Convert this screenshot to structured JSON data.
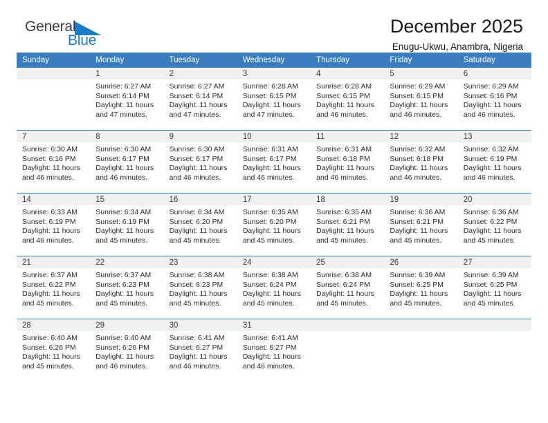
{
  "logo": {
    "word1": "General",
    "word2": "Blue",
    "triangle_color": "#1f7ac4",
    "word1_color": "#3b3b3b",
    "word2_color": "#1f7ac4"
  },
  "header": {
    "title": "December 2025",
    "subtitle": "Enugu-Ukwu, Anambra, Nigeria"
  },
  "theme": {
    "header_blue": "#3a7dbf",
    "band_gray": "#f0f0f0",
    "text_dark": "#2b2b2b"
  },
  "weekdays": [
    "Sunday",
    "Monday",
    "Tuesday",
    "Wednesday",
    "Thursday",
    "Friday",
    "Saturday"
  ],
  "weeks": [
    [
      {
        "day": "",
        "empty": true,
        "sunrise": "",
        "sunset": "",
        "daylight_l1": "",
        "daylight_l2": ""
      },
      {
        "day": "1",
        "sunrise": "Sunrise: 6:27 AM",
        "sunset": "Sunset: 6:14 PM",
        "daylight_l1": "Daylight: 11 hours",
        "daylight_l2": "and 47 minutes."
      },
      {
        "day": "2",
        "sunrise": "Sunrise: 6:27 AM",
        "sunset": "Sunset: 6:14 PM",
        "daylight_l1": "Daylight: 11 hours",
        "daylight_l2": "and 47 minutes."
      },
      {
        "day": "3",
        "sunrise": "Sunrise: 6:28 AM",
        "sunset": "Sunset: 6:15 PM",
        "daylight_l1": "Daylight: 11 hours",
        "daylight_l2": "and 47 minutes."
      },
      {
        "day": "4",
        "sunrise": "Sunrise: 6:28 AM",
        "sunset": "Sunset: 6:15 PM",
        "daylight_l1": "Daylight: 11 hours",
        "daylight_l2": "and 46 minutes."
      },
      {
        "day": "5",
        "sunrise": "Sunrise: 6:29 AM",
        "sunset": "Sunset: 6:15 PM",
        "daylight_l1": "Daylight: 11 hours",
        "daylight_l2": "and 46 minutes."
      },
      {
        "day": "6",
        "sunrise": "Sunrise: 6:29 AM",
        "sunset": "Sunset: 6:16 PM",
        "daylight_l1": "Daylight: 11 hours",
        "daylight_l2": "and 46 minutes."
      }
    ],
    [
      {
        "day": "7",
        "sunrise": "Sunrise: 6:30 AM",
        "sunset": "Sunset: 6:16 PM",
        "daylight_l1": "Daylight: 11 hours",
        "daylight_l2": "and 46 minutes."
      },
      {
        "day": "8",
        "sunrise": "Sunrise: 6:30 AM",
        "sunset": "Sunset: 6:17 PM",
        "daylight_l1": "Daylight: 11 hours",
        "daylight_l2": "and 46 minutes."
      },
      {
        "day": "9",
        "sunrise": "Sunrise: 6:30 AM",
        "sunset": "Sunset: 6:17 PM",
        "daylight_l1": "Daylight: 11 hours",
        "daylight_l2": "and 46 minutes."
      },
      {
        "day": "10",
        "sunrise": "Sunrise: 6:31 AM",
        "sunset": "Sunset: 6:17 PM",
        "daylight_l1": "Daylight: 11 hours",
        "daylight_l2": "and 46 minutes."
      },
      {
        "day": "11",
        "sunrise": "Sunrise: 6:31 AM",
        "sunset": "Sunset: 6:18 PM",
        "daylight_l1": "Daylight: 11 hours",
        "daylight_l2": "and 46 minutes."
      },
      {
        "day": "12",
        "sunrise": "Sunrise: 6:32 AM",
        "sunset": "Sunset: 6:18 PM",
        "daylight_l1": "Daylight: 11 hours",
        "daylight_l2": "and 46 minutes."
      },
      {
        "day": "13",
        "sunrise": "Sunrise: 6:32 AM",
        "sunset": "Sunset: 6:19 PM",
        "daylight_l1": "Daylight: 11 hours",
        "daylight_l2": "and 46 minutes."
      }
    ],
    [
      {
        "day": "14",
        "sunrise": "Sunrise: 6:33 AM",
        "sunset": "Sunset: 6:19 PM",
        "daylight_l1": "Daylight: 11 hours",
        "daylight_l2": "and 46 minutes."
      },
      {
        "day": "15",
        "sunrise": "Sunrise: 6:34 AM",
        "sunset": "Sunset: 6:19 PM",
        "daylight_l1": "Daylight: 11 hours",
        "daylight_l2": "and 45 minutes."
      },
      {
        "day": "16",
        "sunrise": "Sunrise: 6:34 AM",
        "sunset": "Sunset: 6:20 PM",
        "daylight_l1": "Daylight: 11 hours",
        "daylight_l2": "and 45 minutes."
      },
      {
        "day": "17",
        "sunrise": "Sunrise: 6:35 AM",
        "sunset": "Sunset: 6:20 PM",
        "daylight_l1": "Daylight: 11 hours",
        "daylight_l2": "and 45 minutes."
      },
      {
        "day": "18",
        "sunrise": "Sunrise: 6:35 AM",
        "sunset": "Sunset: 6:21 PM",
        "daylight_l1": "Daylight: 11 hours",
        "daylight_l2": "and 45 minutes."
      },
      {
        "day": "19",
        "sunrise": "Sunrise: 6:36 AM",
        "sunset": "Sunset: 6:21 PM",
        "daylight_l1": "Daylight: 11 hours",
        "daylight_l2": "and 45 minutes."
      },
      {
        "day": "20",
        "sunrise": "Sunrise: 6:36 AM",
        "sunset": "Sunset: 6:22 PM",
        "daylight_l1": "Daylight: 11 hours",
        "daylight_l2": "and 45 minutes."
      }
    ],
    [
      {
        "day": "21",
        "sunrise": "Sunrise: 6:37 AM",
        "sunset": "Sunset: 6:22 PM",
        "daylight_l1": "Daylight: 11 hours",
        "daylight_l2": "and 45 minutes."
      },
      {
        "day": "22",
        "sunrise": "Sunrise: 6:37 AM",
        "sunset": "Sunset: 6:23 PM",
        "daylight_l1": "Daylight: 11 hours",
        "daylight_l2": "and 45 minutes."
      },
      {
        "day": "23",
        "sunrise": "Sunrise: 6:38 AM",
        "sunset": "Sunset: 6:23 PM",
        "daylight_l1": "Daylight: 11 hours",
        "daylight_l2": "and 45 minutes."
      },
      {
        "day": "24",
        "sunrise": "Sunrise: 6:38 AM",
        "sunset": "Sunset: 6:24 PM",
        "daylight_l1": "Daylight: 11 hours",
        "daylight_l2": "and 45 minutes."
      },
      {
        "day": "25",
        "sunrise": "Sunrise: 6:38 AM",
        "sunset": "Sunset: 6:24 PM",
        "daylight_l1": "Daylight: 11 hours",
        "daylight_l2": "and 45 minutes."
      },
      {
        "day": "26",
        "sunrise": "Sunrise: 6:39 AM",
        "sunset": "Sunset: 6:25 PM",
        "daylight_l1": "Daylight: 11 hours",
        "daylight_l2": "and 45 minutes."
      },
      {
        "day": "27",
        "sunrise": "Sunrise: 6:39 AM",
        "sunset": "Sunset: 6:25 PM",
        "daylight_l1": "Daylight: 11 hours",
        "daylight_l2": "and 45 minutes."
      }
    ],
    [
      {
        "day": "28",
        "sunrise": "Sunrise: 6:40 AM",
        "sunset": "Sunset: 6:26 PM",
        "daylight_l1": "Daylight: 11 hours",
        "daylight_l2": "and 45 minutes."
      },
      {
        "day": "29",
        "sunrise": "Sunrise: 6:40 AM",
        "sunset": "Sunset: 6:26 PM",
        "daylight_l1": "Daylight: 11 hours",
        "daylight_l2": "and 46 minutes."
      },
      {
        "day": "30",
        "sunrise": "Sunrise: 6:41 AM",
        "sunset": "Sunset: 6:27 PM",
        "daylight_l1": "Daylight: 11 hours",
        "daylight_l2": "and 46 minutes."
      },
      {
        "day": "31",
        "sunrise": "Sunrise: 6:41 AM",
        "sunset": "Sunset: 6:27 PM",
        "daylight_l1": "Daylight: 11 hours",
        "daylight_l2": "and 46 minutes."
      },
      {
        "day": "",
        "empty": true,
        "sunrise": "",
        "sunset": "",
        "daylight_l1": "",
        "daylight_l2": ""
      },
      {
        "day": "",
        "empty": true,
        "sunrise": "",
        "sunset": "",
        "daylight_l1": "",
        "daylight_l2": ""
      },
      {
        "day": "",
        "empty": true,
        "sunrise": "",
        "sunset": "",
        "daylight_l1": "",
        "daylight_l2": ""
      }
    ]
  ]
}
